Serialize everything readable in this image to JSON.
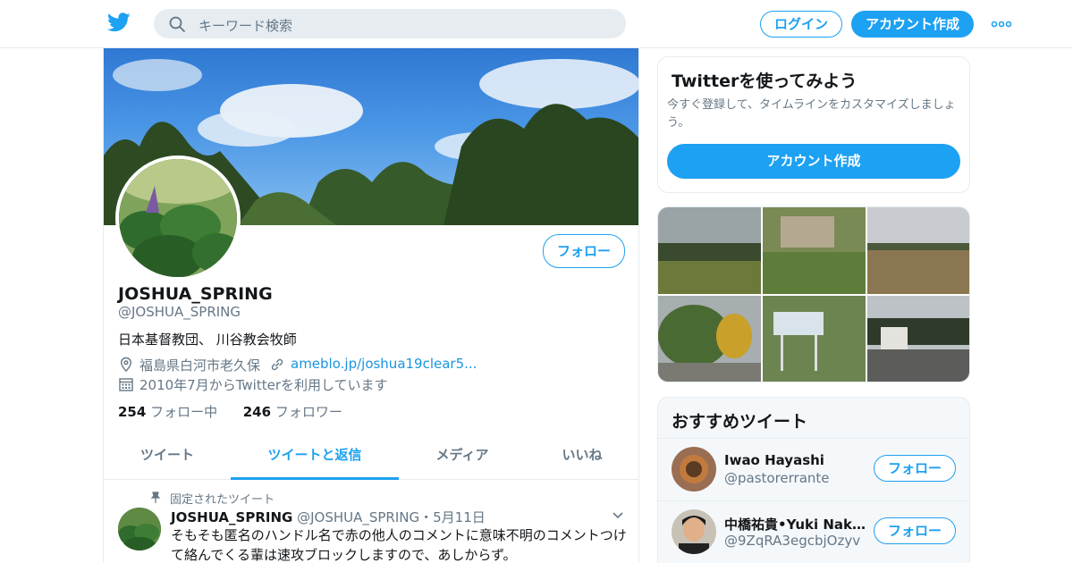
{
  "header": {
    "search_placeholder": "キーワード検索",
    "login_label": "ログイン",
    "signup_label": "アカウント作成"
  },
  "profile": {
    "follow_label": "フォロー",
    "name": "JOSHUA_SPRING",
    "handle": "@JOSHUA_SPRING",
    "bio": "日本基督教団、 川谷教会牧師",
    "location": "福島県白河市老久保",
    "url": "ameblo.jp/joshua19clear5...",
    "joined": "2010年7月からTwitterを利用しています",
    "following_count": "254",
    "following_label": "フォロー中",
    "followers_count": "246",
    "followers_label": "フォロワー"
  },
  "tabs": [
    {
      "label": "ツイート"
    },
    {
      "label": "ツイートと返信"
    },
    {
      "label": "メディア"
    },
    {
      "label": "いいね"
    }
  ],
  "tweet": {
    "pinned_label": "固定されたツイート",
    "author": "JOSHUA_SPRING",
    "handle": "@JOSHUA_SPRING",
    "date": "・5月11日",
    "text": "そもそも匿名のハンドル名で赤の他人のコメントに意味不明のコメントつけて絡んでくる輩は速攻ブロックしますので、あしからず。"
  },
  "signup_card": {
    "title": "Twitterを使ってみよう",
    "description": "今すぐ登録して、タイムラインをカスタマイズしましょう。",
    "button_label": "アカウント作成"
  },
  "recommendations": {
    "title": "おすすめツイート",
    "items": [
      {
        "name": "Iwao Hayashi",
        "handle": "@pastorerrante",
        "follow_label": "フォロー"
      },
      {
        "name": "中橋祐貴•Yuki Nakahashi",
        "handle": "@9ZqRA3egcbjOzyv",
        "follow_label": "フォロー"
      }
    ]
  },
  "colors": {
    "accent": "#1da1f2",
    "link": "#1b95e0",
    "secondary_text": "#657786",
    "border": "#e6ecf0"
  },
  "icons": [
    "twitter-logo-icon",
    "search-icon",
    "more-dots-icon",
    "location-pin-icon",
    "link-icon",
    "calendar-icon",
    "pin-icon",
    "chevron-down-icon"
  ]
}
